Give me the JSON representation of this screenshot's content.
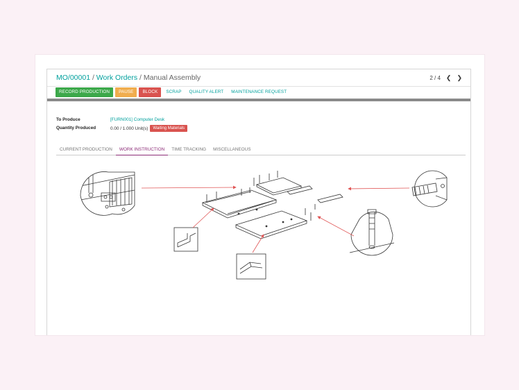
{
  "breadcrumb": {
    "root": "MO/00001",
    "sep1": "/",
    "parent": "Work Orders",
    "sep2": "/",
    "current": "Manual Assembly"
  },
  "pager": {
    "value": "2 / 4",
    "prev_icon": "chevron-left-icon",
    "next_icon": "chevron-right-icon"
  },
  "toolbar": {
    "record_production": "RECORD PRODUCTION",
    "pause": "PAUSE",
    "block": "BLOCK",
    "scrap": "SCRAP",
    "quality_alert": "QUALITY ALERT",
    "maintenance_request": "MAINTENANCE REQUEST"
  },
  "fields": {
    "to_produce_label": "To Produce",
    "to_produce_value": "[FURN001] Computer Desk",
    "quantity_label": "Quantity Produced",
    "quantity_value": "0.00  /  1.000 Unit(s)",
    "status_badge": "Waiting Materials"
  },
  "tabs": [
    {
      "label": "CURRENT PRODUCTION"
    },
    {
      "label": "WORK INSTRUCTION"
    },
    {
      "label": "TIME TRACKING"
    },
    {
      "label": "MISCELLANEOUS"
    }
  ],
  "colors": {
    "accent": "#00a09d",
    "active_tab": "#8b2a76",
    "record_button": "#3ca84a",
    "pause_button": "#f0ad4e",
    "block_button": "#d9534f",
    "drawing_arrow": "#e05555"
  }
}
